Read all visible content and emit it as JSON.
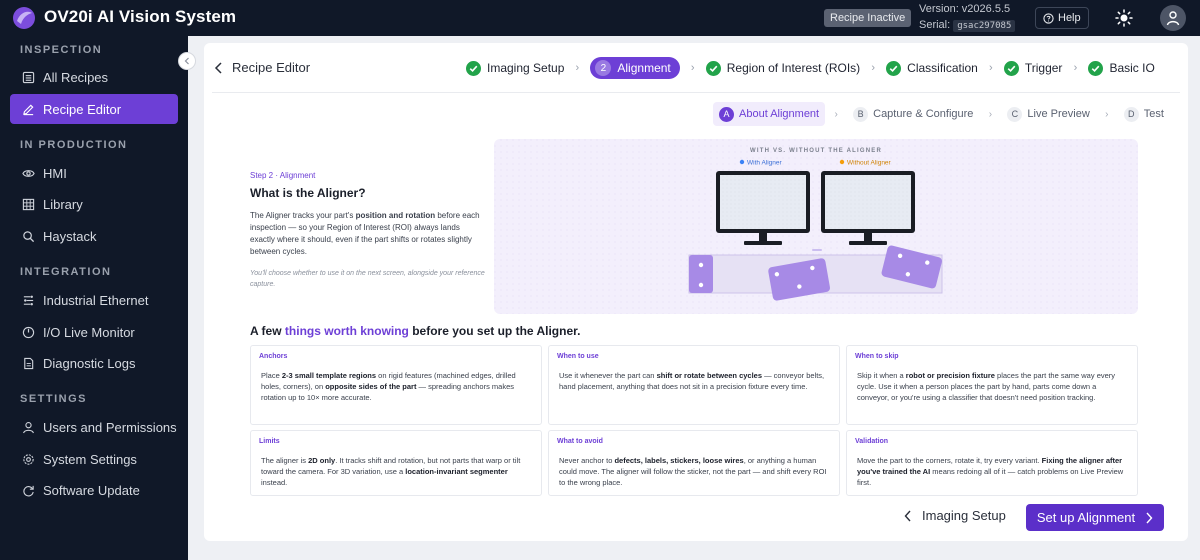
{
  "app": {
    "title": "OV20i AI Vision System",
    "status_badge": "Recipe Inactive",
    "version": "Version: v2026.5.5",
    "serial_label": "Serial:",
    "serial": "gsac297085",
    "help": "Help"
  },
  "sidebar": {
    "sections": [
      {
        "label": "INSPECTION",
        "items": [
          {
            "label": "All Recipes",
            "icon": "list-icon"
          },
          {
            "label": "Recipe Editor",
            "icon": "edit-icon",
            "active": true
          }
        ]
      },
      {
        "label": "IN PRODUCTION",
        "items": [
          {
            "label": "HMI",
            "icon": "eye-icon"
          },
          {
            "label": "Library",
            "icon": "grid-icon"
          },
          {
            "label": "Haystack",
            "icon": "search-icon"
          }
        ]
      },
      {
        "label": "INTEGRATION",
        "items": [
          {
            "label": "Industrial Ethernet",
            "icon": "network-icon"
          },
          {
            "label": "I/O Live Monitor",
            "icon": "io-icon"
          },
          {
            "label": "Diagnostic Logs",
            "icon": "log-icon"
          }
        ]
      },
      {
        "label": "SETTINGS",
        "items": [
          {
            "label": "Users and Permissions",
            "icon": "user-icon"
          },
          {
            "label": "System Settings",
            "icon": "gear-icon"
          },
          {
            "label": "Software Update",
            "icon": "refresh-icon"
          }
        ]
      }
    ]
  },
  "editor": {
    "back_label": "Recipe Editor",
    "steps": [
      {
        "label": "Imaging Setup",
        "state": "done"
      },
      {
        "label": "Alignment",
        "state": "current",
        "number": "2"
      },
      {
        "label": "Region of Interest (ROIs)",
        "state": "done"
      },
      {
        "label": "Classification",
        "state": "done"
      },
      {
        "label": "Trigger",
        "state": "done"
      },
      {
        "label": "Basic IO",
        "state": "done"
      }
    ],
    "substeps": [
      {
        "badge": "A",
        "label": "About Alignment",
        "current": true
      },
      {
        "badge": "B",
        "label": "Capture & Configure"
      },
      {
        "badge": "C",
        "label": "Live Preview"
      },
      {
        "badge": "D",
        "label": "Test"
      }
    ]
  },
  "intro": {
    "step_tag": "Step 2 · Alignment",
    "title": "What is the Aligner?",
    "body_pre": "The Aligner tracks your part's ",
    "body_bold": "position and rotation",
    "body_post": " before each inspection — so your Region of Interest (ROI) always lands exactly where it should, even if the part shifts or rotates slightly between cycles.",
    "note": "You'll choose whether to use it on the next screen, alongside your reference capture."
  },
  "illustration": {
    "header": "WITH VS. WITHOUT THE ALIGNER",
    "legend_with": "With Aligner",
    "legend_without": "Without Aligner",
    "color_with": "#3b82f6",
    "color_without": "#f59e0b"
  },
  "worth": {
    "pre": "A few ",
    "highlight": "things worth knowing",
    "post": " before you set up the Aligner."
  },
  "tiles": [
    {
      "title": "Anchors",
      "parts": [
        {
          "t": "Place "
        },
        {
          "t": "2-3 small template regions",
          "b": true
        },
        {
          "t": " on rigid features (machined edges, drilled holes, corners), on "
        },
        {
          "t": "opposite sides of the part",
          "b": true
        },
        {
          "t": " — spreading anchors makes rotation up to 10× more accurate."
        }
      ]
    },
    {
      "title": "When to use",
      "parts": [
        {
          "t": "Use it whenever the part can "
        },
        {
          "t": "shift or rotate between cycles",
          "b": true
        },
        {
          "t": " — conveyor belts, hand placement, anything that does not sit in a precision fixture every time."
        }
      ]
    },
    {
      "title": "When to skip",
      "parts": [
        {
          "t": "Skip it when a "
        },
        {
          "t": "robot or precision fixture",
          "b": true
        },
        {
          "t": " places the part the same way every cycle. Use it when a person places the part by hand, parts come down a conveyor, or you're using a classifier that doesn't need position tracking."
        }
      ]
    },
    {
      "title": "Limits",
      "parts": [
        {
          "t": "The aligner is "
        },
        {
          "t": "2D only",
          "b": true
        },
        {
          "t": ". It tracks shift and rotation, but not parts that warp or tilt toward the camera. For 3D variation, use a "
        },
        {
          "t": "location-invariant segmenter",
          "b": true
        },
        {
          "t": " instead."
        }
      ]
    },
    {
      "title": "What to avoid",
      "parts": [
        {
          "t": "Never anchor to "
        },
        {
          "t": "defects, labels, stickers, loose wires",
          "b": true
        },
        {
          "t": ", or anything a human could move. The aligner will follow the sticker, not the part — and shift every ROI to the wrong place."
        }
      ]
    },
    {
      "title": "Validation",
      "parts": [
        {
          "t": "Move the part to the corners, rotate it, try every variant. "
        },
        {
          "t": "Fixing the aligner after you've trained the AI",
          "b": true
        },
        {
          "t": " means redoing all of it — catch problems on Live Preview first."
        }
      ]
    }
  ],
  "footer": {
    "back_label": "Imaging Setup",
    "next_label": "Set up Alignment"
  },
  "colors": {
    "accent": "#6d3fd6",
    "sidebar_bg": "#101828",
    "success": "#22a34a"
  }
}
